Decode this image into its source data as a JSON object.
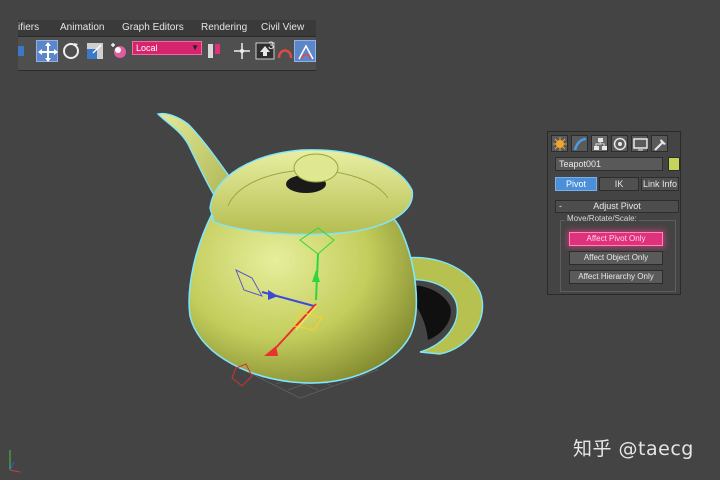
{
  "menu": {
    "items": [
      "ifiers",
      "Animation",
      "Graph Editors",
      "Rendering",
      "Civil View"
    ]
  },
  "toolbar": {
    "reference_coord": "Local",
    "snap_value": "3",
    "icons": [
      "link-icon",
      "select-move-icon",
      "rotate-icon",
      "scale-icon",
      "select-object-icon",
      "ref-coord-dropdown",
      "pivot-center-icon",
      "select-manipulate-icon",
      "keyboard-shortcut-icon",
      "snap-toggle-icon",
      "angle-snap-icon",
      "percent-snap-icon"
    ]
  },
  "command_panel": {
    "tabs": [
      "create-tab",
      "modify-tab",
      "hierarchy-tab",
      "motion-tab",
      "display-tab",
      "utilities-tab"
    ],
    "object_name": "Teapot001",
    "object_color": "#c6d45b",
    "subtabs": [
      "Pivot",
      "IK",
      "Link Info"
    ],
    "active_subtab": "Pivot",
    "rollout": {
      "toggle": "-",
      "title": "Adjust Pivot",
      "group_label": "Move/Rotate/Scale:",
      "buttons": [
        "Affect Pivot Only",
        "Affect Object Only",
        "Affect Hierarchy Only"
      ]
    }
  },
  "viewport": {
    "object": "teapot",
    "background": "#444444",
    "accent": "#e0327c"
  },
  "watermark": "知乎 @taecg"
}
